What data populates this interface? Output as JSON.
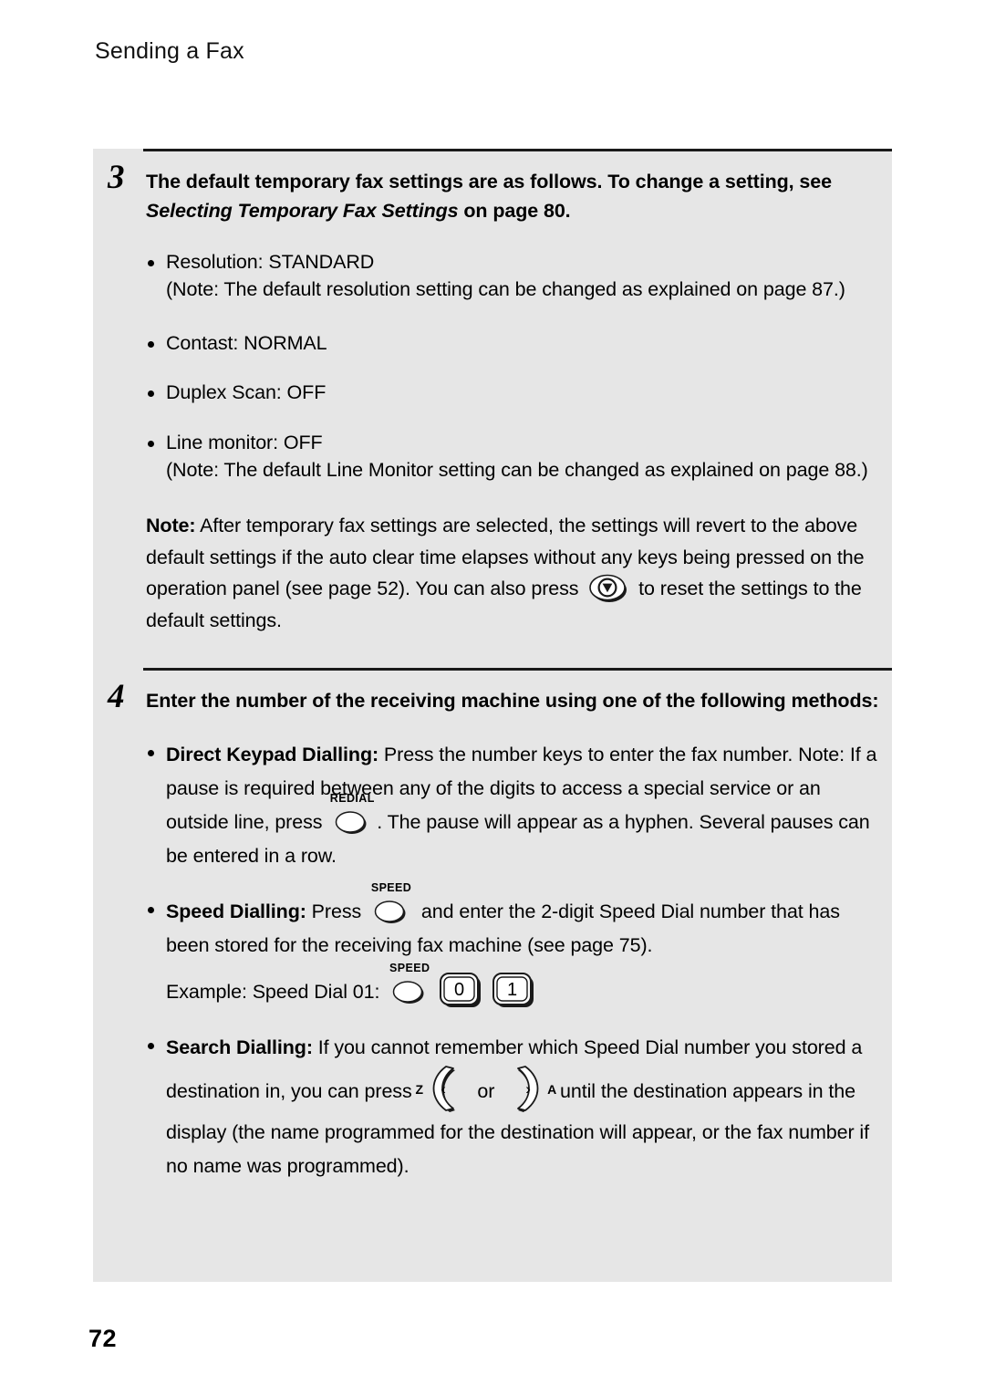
{
  "page": {
    "running_head": "Sending a Fax",
    "folio": "72",
    "panel_bg": "#e6e6e6",
    "text_color": "#000000"
  },
  "steps": [
    {
      "number": "3",
      "heading_part1": "The default temporary fax settings are as follows. To change a setting, see ",
      "heading_italic": "Selecting Temporary Fax Settings",
      "heading_part2": " on page 80.",
      "bullets": [
        {
          "text": "Resolution: STANDARD",
          "note": "(Note: The default resolution setting can be changed as explained on page 87.)"
        },
        {
          "text": "Contast: NORMAL",
          "note": ""
        },
        {
          "text": "Duplex Scan: OFF",
          "note": ""
        },
        {
          "text": "Line monitor: OFF",
          "note": "(Note: The default Line Monitor setting can be changed as explained on page 88.)"
        }
      ],
      "note": {
        "label": "Note:",
        "part1": " After temporary fax settings are selected, the settings will revert to the above default settings if the auto clear time elapses without any keys being pressed on the operation panel (see page 52). You can also press ",
        "key": "stop-key",
        "part2": " to reset the settings to the default settings."
      }
    },
    {
      "number": "4",
      "heading_part1": "Enter the number of the receiving machine using one of the following methods:",
      "heading_italic": "",
      "heading_part2": "",
      "methods": [
        {
          "name": "Direct Keypad Dialling:",
          "part1": " Press the number keys to enter the fax number. Note: If a pause is required between any of the digits to access a special service or an outside line, press ",
          "key_label": "REDIAL",
          "part2": ". The pause will appear as a hyphen. Several pauses can be entered in a row."
        },
        {
          "name": "Speed Dialling:",
          "part1": " Press ",
          "key_label": "SPEED",
          "part2": " and enter the 2-digit Speed Dial number that has been stored for the receiving fax machine (see page 75).",
          "example_prefix": "Example: Speed Dial 01:",
          "example_key_label": "SPEED",
          "example_digits": [
            "0",
            "1"
          ]
        },
        {
          "name": "Search Dialling:",
          "part1": " If you cannot remember which Speed Dial number you stored a destination in, you can press ",
          "left_key_label": "Z",
          "left_key_glyph": "‹",
          "conjunction": " or ",
          "right_key_glyph": "›",
          "right_key_label": "A",
          "part2": " until the destination appears in the display (the name programmed for the destination will appear, or the fax number if no name was programmed)."
        }
      ]
    }
  ]
}
